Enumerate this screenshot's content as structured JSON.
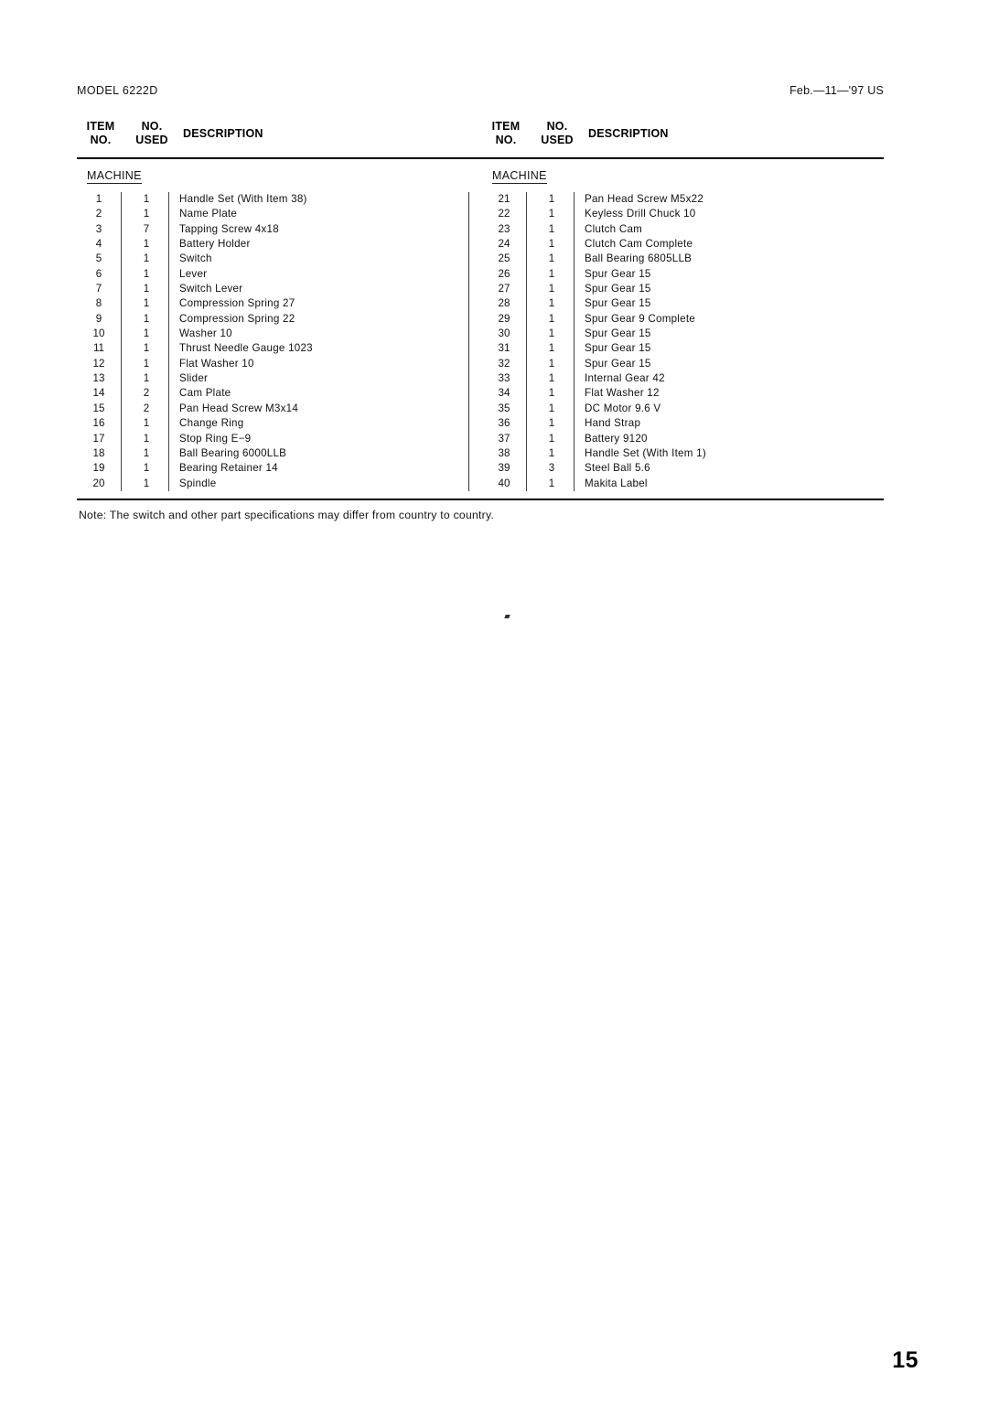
{
  "document": {
    "model_label": "MODEL 6222D",
    "date_label": "Feb.—11—'97 US",
    "page_number": "15",
    "note": "Note: The switch and other part specifications may differ from country to country."
  },
  "table_headers": {
    "item_no": "ITEM\nNO.",
    "no_used": "NO.\nUSED",
    "description": "DESCRIPTION"
  },
  "sections": {
    "left_heading": "MACHINE",
    "right_heading": "MACHINE"
  },
  "parts_left": [
    {
      "item": "1",
      "used": "1",
      "desc": "Handle Set (With Item 38)"
    },
    {
      "item": "2",
      "used": "1",
      "desc": "Name Plate"
    },
    {
      "item": "3",
      "used": "7",
      "desc": "Tapping Screw 4x18"
    },
    {
      "item": "4",
      "used": "1",
      "desc": "Battery Holder"
    },
    {
      "item": "5",
      "used": "1",
      "desc": "Switch"
    },
    {
      "item": "6",
      "used": "1",
      "desc": "Lever"
    },
    {
      "item": "7",
      "used": "1",
      "desc": "Switch Lever"
    },
    {
      "item": "8",
      "used": "1",
      "desc": "Compression Spring 27"
    },
    {
      "item": "9",
      "used": "1",
      "desc": "Compression Spring 22"
    },
    {
      "item": "10",
      "used": "1",
      "desc": "Washer 10"
    },
    {
      "item": "11",
      "used": "1",
      "desc": "Thrust Needle Gauge 1023"
    },
    {
      "item": "12",
      "used": "1",
      "desc": "Flat Washer 10"
    },
    {
      "item": "13",
      "used": "1",
      "desc": "Slider"
    },
    {
      "item": "14",
      "used": "2",
      "desc": "Cam Plate"
    },
    {
      "item": "15",
      "used": "2",
      "desc": "Pan Head Screw M3x14"
    },
    {
      "item": "16",
      "used": "1",
      "desc": "Change Ring"
    },
    {
      "item": "17",
      "used": "1",
      "desc": "Stop Ring E−9"
    },
    {
      "item": "18",
      "used": "1",
      "desc": "Ball Bearing 6000LLB"
    },
    {
      "item": "19",
      "used": "1",
      "desc": "Bearing Retainer 14"
    },
    {
      "item": "20",
      "used": "1",
      "desc": "Spindle"
    }
  ],
  "parts_right": [
    {
      "item": "21",
      "used": "1",
      "desc": "Pan Head Screw M5x22"
    },
    {
      "item": "22",
      "used": "1",
      "desc": "Keyless Drill Chuck 10"
    },
    {
      "item": "23",
      "used": "1",
      "desc": "Clutch Cam"
    },
    {
      "item": "24",
      "used": "1",
      "desc": "Clutch Cam Complete"
    },
    {
      "item": "25",
      "used": "1",
      "desc": "Ball Bearing 6805LLB"
    },
    {
      "item": "26",
      "used": "1",
      "desc": "Spur Gear 15"
    },
    {
      "item": "27",
      "used": "1",
      "desc": "Spur Gear 15"
    },
    {
      "item": "28",
      "used": "1",
      "desc": "Spur Gear 15"
    },
    {
      "item": "29",
      "used": "1",
      "desc": "Spur Gear 9 Complete"
    },
    {
      "item": "30",
      "used": "1",
      "desc": "Spur Gear 15"
    },
    {
      "item": "31",
      "used": "1",
      "desc": "Spur Gear 15"
    },
    {
      "item": "32",
      "used": "1",
      "desc": "Spur Gear 15"
    },
    {
      "item": "33",
      "used": "1",
      "desc": "Internal Gear 42"
    },
    {
      "item": "34",
      "used": "1",
      "desc": "Flat Washer 12"
    },
    {
      "item": "35",
      "used": "1",
      "desc": "DC Motor 9.6 V"
    },
    {
      "item": "36",
      "used": "1",
      "desc": "Hand Strap"
    },
    {
      "item": "37",
      "used": "1",
      "desc": "Battery 9120"
    },
    {
      "item": "38",
      "used": "1",
      "desc": "Handle Set (With Item 1)"
    },
    {
      "item": "39",
      "used": "3",
      "desc": "Steel Ball 5.6"
    },
    {
      "item": "40",
      "used": "1",
      "desc": "Makita Label"
    }
  ]
}
